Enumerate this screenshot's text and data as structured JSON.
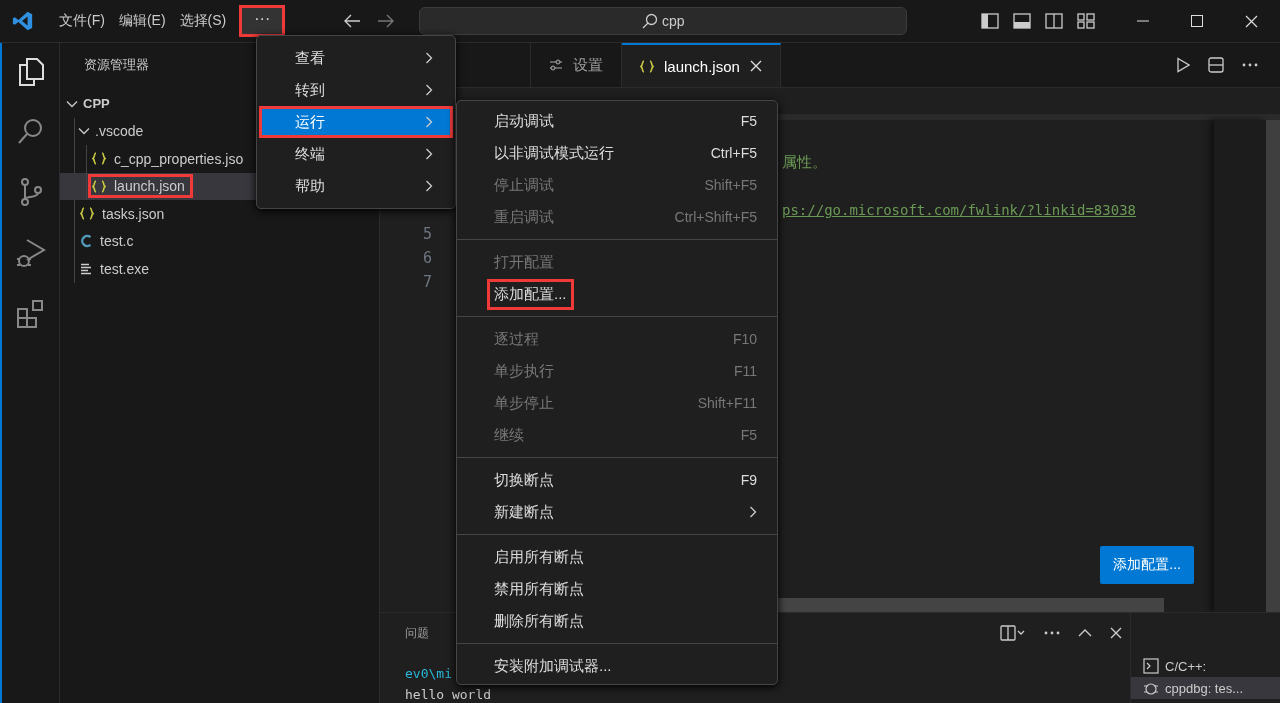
{
  "titlebar": {
    "menus": [
      {
        "label": "文件(F)"
      },
      {
        "label": "编辑(E)"
      },
      {
        "label": "选择(S)"
      }
    ],
    "more_button": {
      "label": "···",
      "highlighted": true
    },
    "search": {
      "value": "cpp"
    }
  },
  "sidebar": {
    "title": "资源管理器",
    "tree": [
      {
        "label": "CPP",
        "kind": "root",
        "expanded": true,
        "children": [
          {
            "label": ".vscode",
            "kind": "folder",
            "expanded": true,
            "children": [
              {
                "label": "c_cpp_properties.jso",
                "kind": "json",
                "selected": false,
                "highlighted": false
              },
              {
                "label": "launch.json",
                "kind": "json",
                "selected": true,
                "highlighted": true
              }
            ]
          },
          {
            "label": "tasks.json",
            "kind": "json",
            "selected": false,
            "highlighted": false
          },
          {
            "label": "test.c",
            "kind": "c",
            "selected": false,
            "highlighted": false
          },
          {
            "label": "test.exe",
            "kind": "binary",
            "selected": false,
            "highlighted": false
          }
        ]
      }
    ]
  },
  "editor": {
    "tabs": [
      {
        "label": "设置",
        "kind": "settings",
        "selected": false
      },
      {
        "label": "launch.json",
        "kind": "json",
        "selected": true
      }
    ],
    "lines": [
      {
        "kind": "blank"
      },
      {
        "text": "属性。",
        "kind": "comment"
      },
      {
        "kind": "blank"
      },
      {
        "text": "ps://go.microsoft.com/fwlink/?linkid=83038",
        "kind": "link"
      },
      {
        "number": "5"
      },
      {
        "number": "6"
      },
      {
        "number": "7"
      }
    ],
    "add_config_button": "添加配置..."
  },
  "panel": {
    "tabs": [
      {
        "label": "问题"
      }
    ],
    "terminal_lines": [
      "ev0\\mi",
      "hello world"
    ],
    "terminals": [
      {
        "label": "C/C++:",
        "kind": "terminal",
        "selected": false
      },
      {
        "label": "cppdbg: tes...",
        "kind": "debug",
        "selected": true
      }
    ]
  },
  "menu": {
    "items": [
      {
        "label": "查看",
        "selected": false,
        "highlighted": false
      },
      {
        "label": "转到",
        "selected": false,
        "highlighted": false
      },
      {
        "label": "运行",
        "selected": true,
        "highlighted": true
      },
      {
        "label": "终端",
        "selected": false,
        "highlighted": false
      },
      {
        "label": "帮助",
        "selected": false,
        "highlighted": false
      }
    ]
  },
  "submenu": {
    "groups": [
      [
        {
          "label": "启动调试",
          "shortcut": "F5",
          "disabled": false
        },
        {
          "label": "以非调试模式运行",
          "shortcut": "Ctrl+F5",
          "disabled": false
        },
        {
          "label": "停止调试",
          "shortcut": "Shift+F5",
          "disabled": true
        },
        {
          "label": "重启调试",
          "shortcut": "Ctrl+Shift+F5",
          "disabled": true
        }
      ],
      [
        {
          "label": "打开配置",
          "disabled": true
        },
        {
          "label": "添加配置...",
          "disabled": false,
          "highlighted": true
        }
      ],
      [
        {
          "label": "逐过程",
          "shortcut": "F10",
          "disabled": true
        },
        {
          "label": "单步执行",
          "shortcut": "F11",
          "disabled": true
        },
        {
          "label": "单步停止",
          "shortcut": "Shift+F11",
          "disabled": true
        },
        {
          "label": "继续",
          "shortcut": "F5",
          "disabled": true
        }
      ],
      [
        {
          "label": "切换断点",
          "shortcut": "F9",
          "disabled": false
        },
        {
          "label": "新建断点",
          "disabled": false,
          "has_submenu": true
        }
      ],
      [
        {
          "label": "启用所有断点",
          "disabled": false
        },
        {
          "label": "禁用所有断点",
          "disabled": false
        },
        {
          "label": "删除所有断点",
          "disabled": false
        }
      ],
      [
        {
          "label": "安装附加调试器...",
          "disabled": false
        }
      ]
    ]
  }
}
